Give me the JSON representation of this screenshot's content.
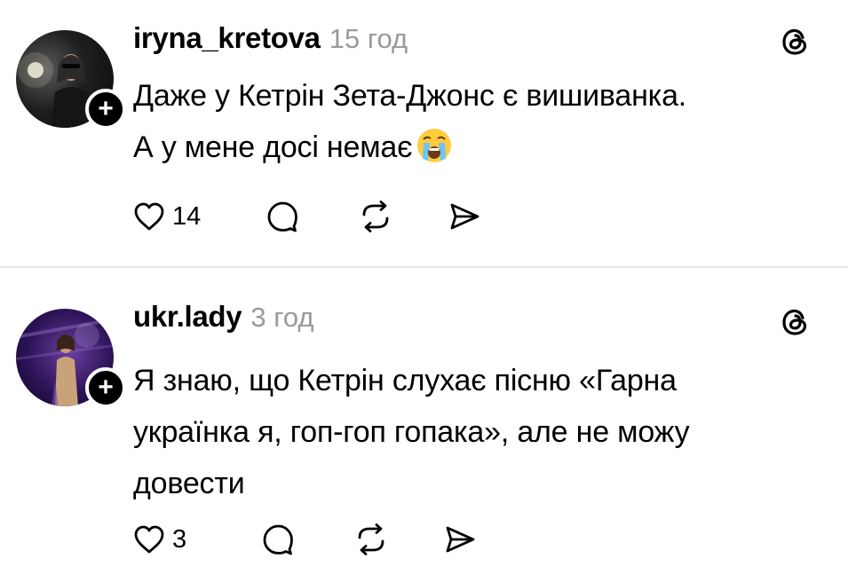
{
  "posts": [
    {
      "username": "iryna_kretova",
      "time": "15 год",
      "text_lines": [
        "Даже у Кетрін Зета-Джонс є вишиванка.",
        "А у мене досі немає"
      ],
      "emoji": "loudly-crying-face",
      "likes": "14",
      "follow_label": "+"
    },
    {
      "username": "ukr.lady",
      "time": "3 год",
      "text_lines": [
        "Я знаю, що Кетрін слухає пісню «Гарна",
        "українка я, гоп-гоп гопака», але не можу",
        "довести"
      ],
      "likes": "3",
      "follow_label": "+"
    }
  ],
  "icons": {
    "platform": "threads-icon",
    "like": "heart-icon",
    "comment": "comment-icon",
    "repost": "repost-icon",
    "share": "share-icon"
  },
  "colors": {
    "text": "#000000",
    "muted": "#9a9a9a",
    "divider": "#e6e6e6",
    "background": "#ffffff"
  }
}
